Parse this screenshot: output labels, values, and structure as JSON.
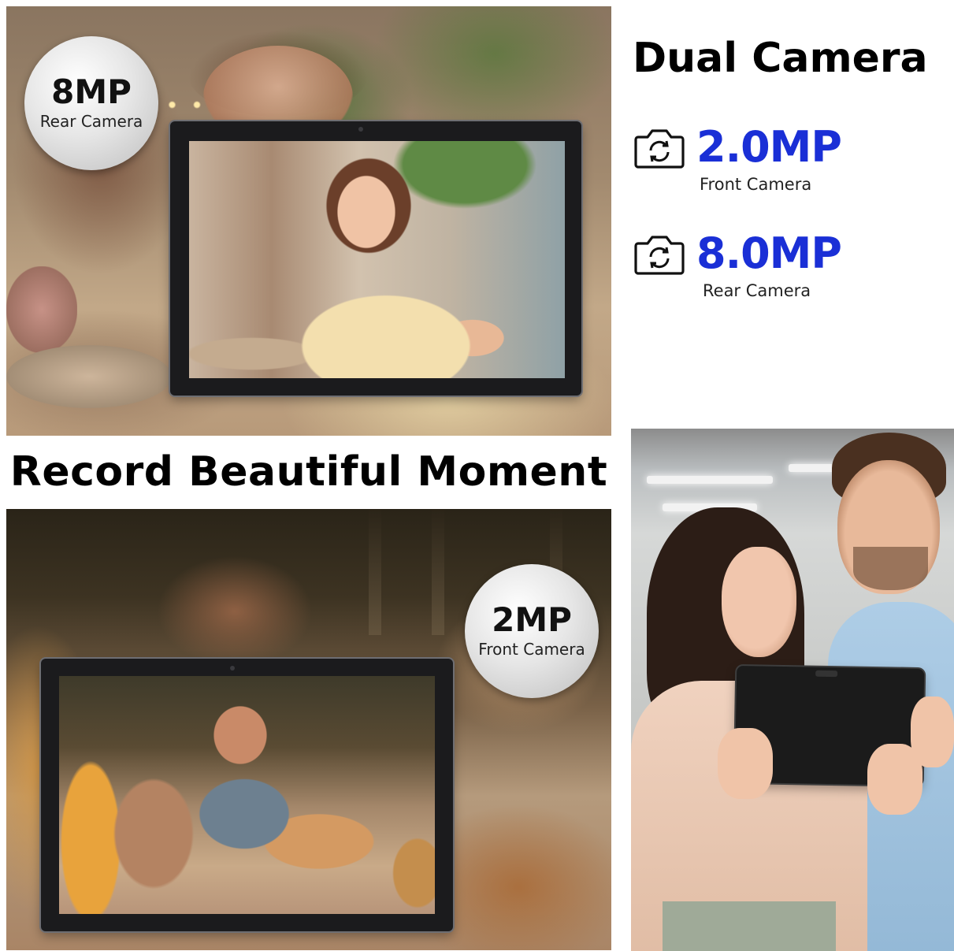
{
  "top_panel": {
    "badge_value": "8MP",
    "badge_label": "Rear Camera"
  },
  "headline": "Record Beautiful Moment",
  "bottom_panel": {
    "badge_value": "2MP",
    "badge_label": "Front Camera"
  },
  "specs": {
    "title": "Dual Camera",
    "items": [
      {
        "value": "2.0MP",
        "label": "Front Camera",
        "icon": "camera-icon"
      },
      {
        "value": "8.0MP",
        "label": "Rear Camera",
        "icon": "camera-icon"
      }
    ],
    "accent_color": "#1a2fd6"
  }
}
